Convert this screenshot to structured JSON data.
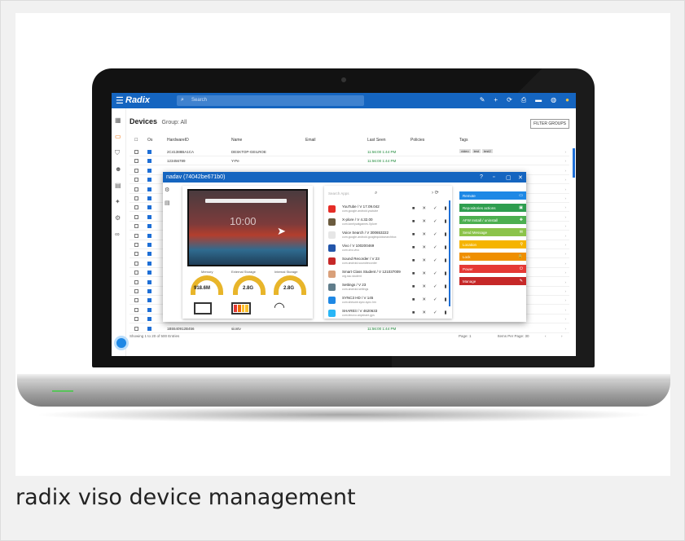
{
  "caption": "radix viso device management",
  "app": {
    "brand": "Radix",
    "search_placeholder": "Search",
    "page_title": "Devices",
    "group_label": "Group: All",
    "filter_button": "FILTER GROUPS",
    "columns": [
      "Os",
      "HardwareID",
      "Name",
      "Email",
      "Last Seen",
      "Policies",
      "Tags"
    ],
    "rows": [
      {
        "hw": "2C41388BA1CA",
        "name": "DESKTOP-GEILROE",
        "seen": "11:56:00 1:44 PM",
        "tags": [
          "video",
          "test",
          "test2"
        ]
      },
      {
        "hw": "123456789",
        "name": "Y-Pe",
        "seen": "11:56:00 1:44 PM",
        "tags": []
      },
      {
        "hw": "",
        "name": "",
        "seen": "",
        "tags": []
      },
      {
        "hw": "",
        "name": "",
        "seen": "",
        "tags": []
      },
      {
        "hw": "",
        "name": "",
        "seen": "",
        "tags": []
      },
      {
        "hw": "",
        "name": "",
        "seen": "",
        "tags": []
      },
      {
        "hw": "",
        "name": "",
        "seen": "",
        "tags": []
      },
      {
        "hw": "",
        "name": "",
        "seen": "",
        "tags": []
      },
      {
        "hw": "",
        "name": "",
        "seen": "",
        "tags": []
      },
      {
        "hw": "",
        "name": "",
        "seen": "",
        "tags": []
      },
      {
        "hw": "",
        "name": "",
        "seen": "",
        "tags": []
      },
      {
        "hw": "",
        "name": "",
        "seen": "",
        "tags": []
      },
      {
        "hw": "",
        "name": "",
        "seen": "",
        "tags": []
      },
      {
        "hw": "",
        "name": "",
        "seen": "",
        "tags": []
      },
      {
        "hw": "",
        "name": "",
        "seen": "",
        "tags": []
      },
      {
        "hw": "",
        "name": "",
        "seen": "",
        "tags": []
      },
      {
        "hw": "",
        "name": "",
        "seen": "",
        "tags": []
      },
      {
        "hw": "",
        "name": "",
        "seen": "",
        "tags": []
      },
      {
        "hw": "",
        "name": "",
        "seen": "",
        "tags": []
      },
      {
        "hw": "1B5540912B456",
        "name": "siontv",
        "seen": "11:56:00 1:44 PM",
        "tags": []
      }
    ],
    "footer_left": "Showing 1 to 20 of 500 Entries",
    "footer_page": "Page: 1",
    "footer_items": "Items Per Page: 30"
  },
  "modal": {
    "title": "nadav (74042be671b0)",
    "clock": "10:00",
    "gauges": [
      {
        "label": "Memory",
        "value": "918.6M"
      },
      {
        "label": "External Storage",
        "value": "2.8G"
      },
      {
        "label": "Internal Storage",
        "value": "2.8G"
      }
    ],
    "app_search_placeholder": "Search Apps",
    "apps": [
      {
        "name": "YouTube / V 17.09.042",
        "pkg": "com.google.android.youtube",
        "color": "#e52d27"
      },
      {
        "name": "X-plore / V 4.32.00",
        "pkg": "com.lonelycatgames.Xplore",
        "color": "#6b5b3e"
      },
      {
        "name": "Voice Search / V 300653222",
        "pkg": "com.google.android.googlequicksearchbox",
        "color": "#e6e6e6"
      },
      {
        "name": "Vivo / V 100200469",
        "pkg": "com.vivo.vivo",
        "color": "#2255aa"
      },
      {
        "name": "Sound Recorder / V 23",
        "pkg": "com.android.soundrecorder",
        "color": "#c62828"
      },
      {
        "name": "Smart Class Student / V 121037009",
        "pkg": "org.ssc.student",
        "color": "#d9a07a"
      },
      {
        "name": "Settings / V 23",
        "pkg": "com.android.settings",
        "color": "#607d8b"
      },
      {
        "name": "SYNC3 HD / V 145",
        "pkg": "com.sheuwe.sync.sync.hm",
        "color": "#1e88e5"
      },
      {
        "name": "SHAREit / V 4620633",
        "pkg": "com.lenovo.anyshare.gps",
        "color": "#29b6f6"
      }
    ],
    "actions": [
      {
        "label": "Remote",
        "color": "#1e88e5",
        "icon": "▭"
      },
      {
        "label": "Repositories actions",
        "color": "#2e9e4f",
        "icon": "▣"
      },
      {
        "label": "AFW Install / uninstall",
        "color": "#4caf50",
        "icon": "✚"
      },
      {
        "label": "Send Message",
        "color": "#8bc34a",
        "icon": "✉"
      },
      {
        "label": "Location",
        "color": "#f5b400",
        "icon": "⚲"
      },
      {
        "label": "Lock",
        "color": "#ef8f00",
        "icon": "🔒"
      },
      {
        "label": "Power",
        "color": "#e53935",
        "icon": "⏻"
      },
      {
        "label": "Manage",
        "color": "#c62828",
        "icon": "✎"
      }
    ]
  }
}
